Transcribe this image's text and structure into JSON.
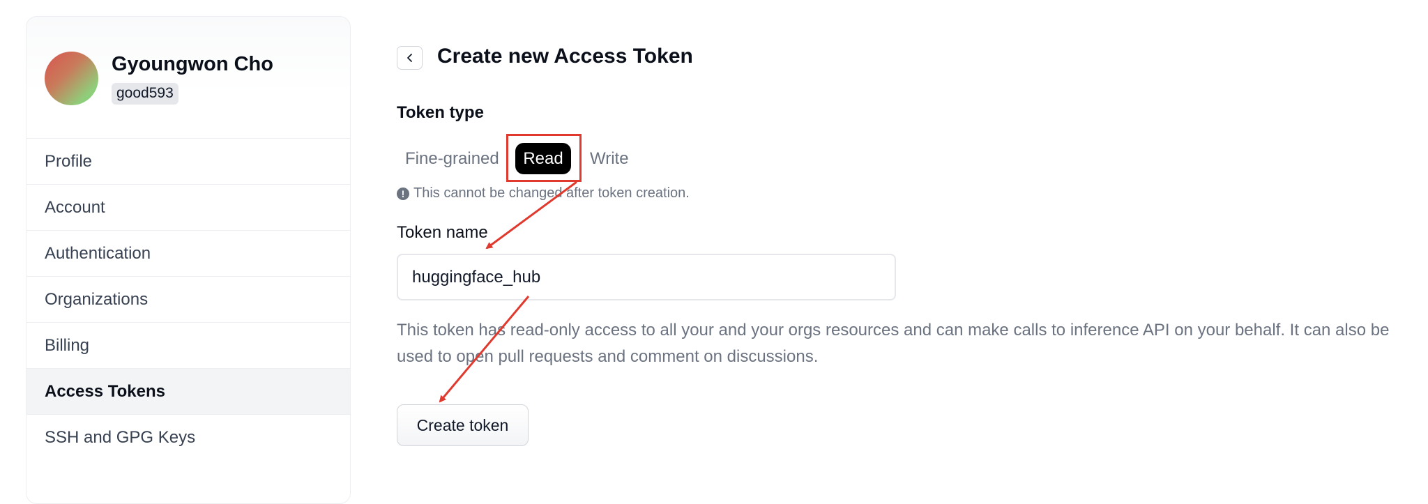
{
  "user": {
    "name": "Gyoungwon Cho",
    "handle": "good593"
  },
  "sidebar": {
    "items": [
      {
        "label": "Profile"
      },
      {
        "label": "Account"
      },
      {
        "label": "Authentication"
      },
      {
        "label": "Organizations"
      },
      {
        "label": "Billing"
      },
      {
        "label": "Access Tokens"
      },
      {
        "label": "SSH and GPG Keys"
      }
    ],
    "active": "Access Tokens"
  },
  "main": {
    "title": "Create new Access Token",
    "token_type_label": "Token type",
    "token_types": [
      "Fine-grained",
      "Read",
      "Write"
    ],
    "selected_token_type": "Read",
    "notice": "This cannot be changed after token creation.",
    "token_name_label": "Token name",
    "token_name_value": "huggingface_hub",
    "description": "This token has read-only access to all your and your orgs resources and can make calls to inference API on your behalf. It can also be used to open pull requests and comment on discussions.",
    "create_button": "Create token"
  },
  "annotations": {
    "color": "#e03a2f"
  }
}
